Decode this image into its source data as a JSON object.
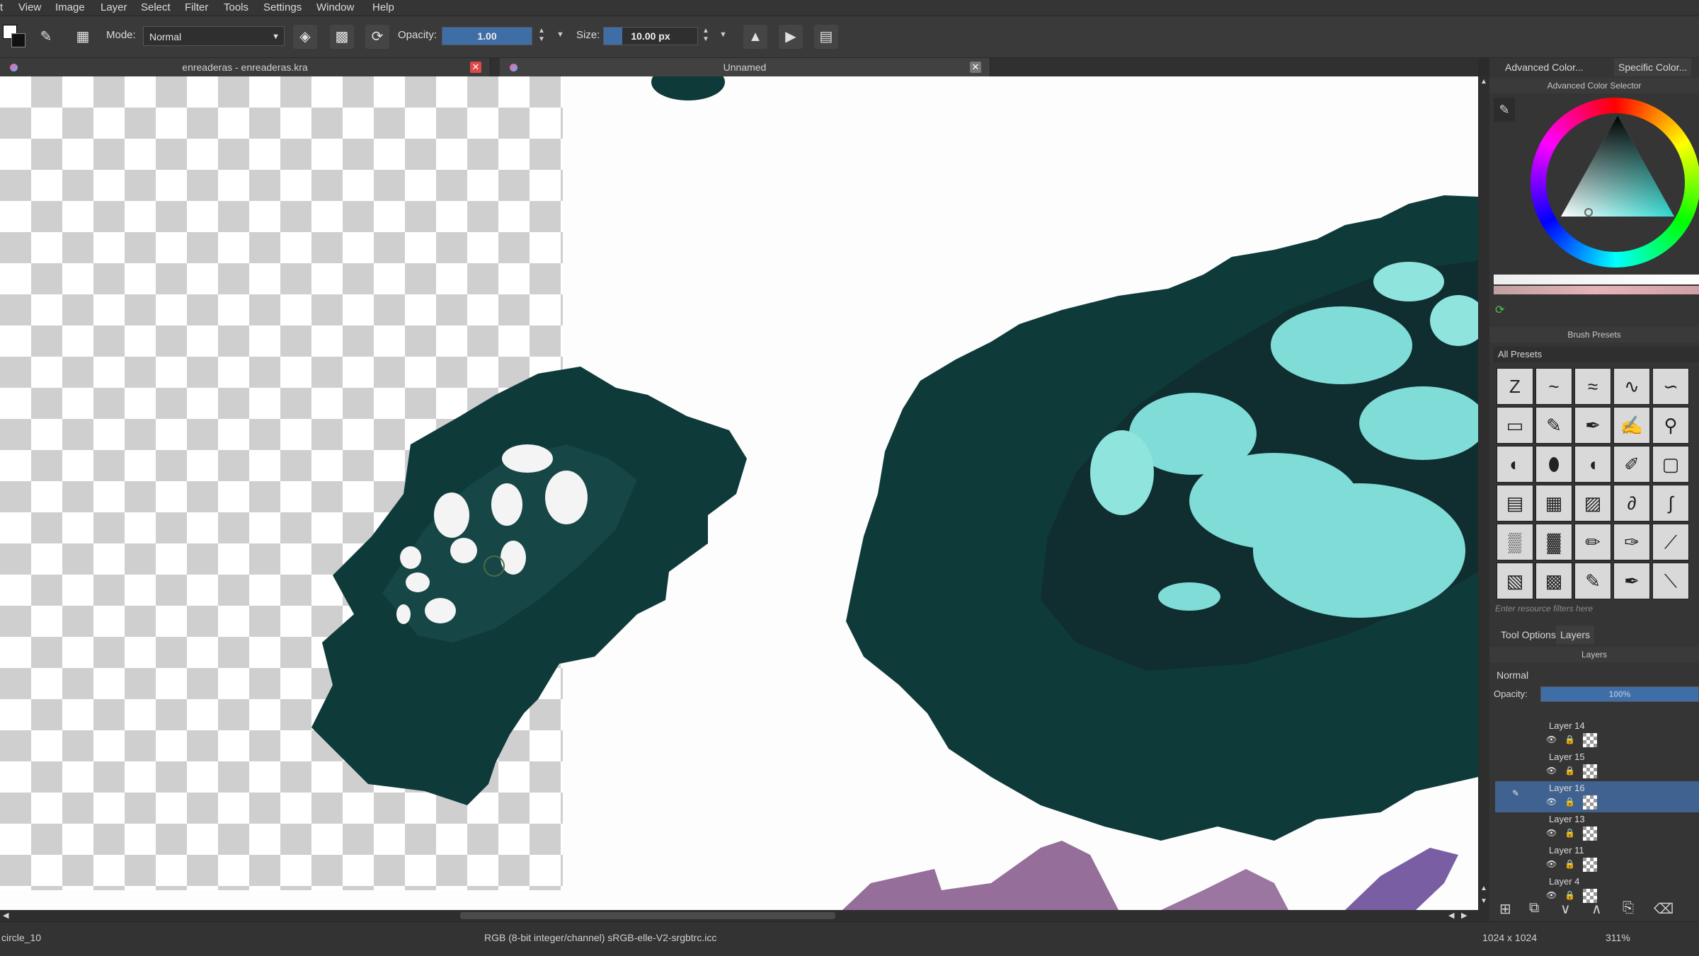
{
  "menu": [
    "t",
    "View",
    "Image",
    "Layer",
    "Select",
    "Filter",
    "Tools",
    "Settings",
    "Window",
    "Help"
  ],
  "toolbar": {
    "mode_label": "Mode:",
    "mode_value": "Normal",
    "opacity_label": "Opacity:",
    "opacity_value": "1.00",
    "opacity_level": 1.0,
    "size_label": "Size:",
    "size_value": "10.00 px"
  },
  "tabs": [
    {
      "name": "enreaderas - enreaderas.kra",
      "close": "✕"
    },
    {
      "name": "Unnamed",
      "close": "✕"
    }
  ],
  "status": {
    "brush": "circle_10",
    "color_profile": "RGB (8-bit integer/channel)  sRGB-elle-V2-srgbtrc.icc",
    "dimensions": "1024 x 1024",
    "zoom": "311%"
  },
  "dock": {
    "color_tabs": [
      "Advanced Color...",
      "Specific Color..."
    ],
    "color_selector_title": "Advanced Color Selector",
    "brush_presets_title": "Brush Presets",
    "presets_filter": "All Presets",
    "resource_filter_placeholder": "Enter resource filters here",
    "lower_tabs": [
      "Tool Options",
      "Layers"
    ],
    "layers_title": "Layers",
    "blend_mode": "Normal",
    "opacity_label": "Opacity:",
    "opacity_value": "100%",
    "layers": [
      {
        "name": "Layer 14",
        "selected": false
      },
      {
        "name": "Layer 15",
        "selected": false
      },
      {
        "name": "Layer 16",
        "selected": true
      },
      {
        "name": "Layer 13",
        "selected": false
      },
      {
        "name": "Layer 11",
        "selected": false
      },
      {
        "name": "Layer 4",
        "selected": false
      }
    ]
  },
  "colors": {
    "foliage": "#0f3a3a",
    "foliage_light": "#1a4d4b",
    "spots_cyan": "#7fdcd6",
    "spots_white": "#f4f4f4",
    "stroke_purple": "#8a5e8f",
    "selection": "#3f6290"
  }
}
